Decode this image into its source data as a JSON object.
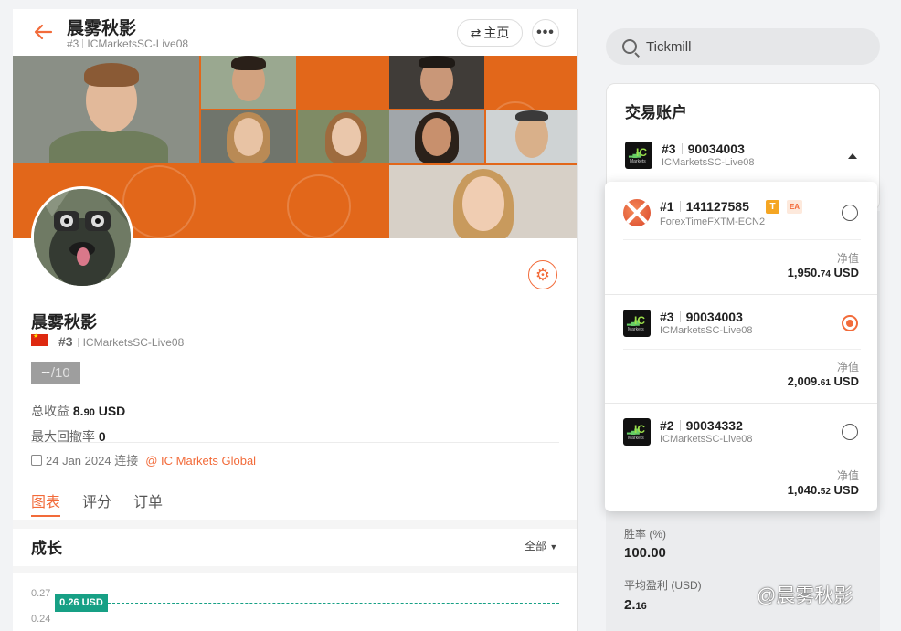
{
  "header": {
    "title": "晨雾秋影",
    "rank": "#3",
    "server": "ICMarketsSC-Live08",
    "home_label": "主页",
    "more_label": "•••"
  },
  "profile": {
    "name": "晨雾秋影",
    "rank": "#3",
    "server": "ICMarketsSC-Live08",
    "score_value": "--",
    "score_max": "/10",
    "total_profit_label": "总收益",
    "total_profit_int": "8.",
    "total_profit_dec": "90",
    "total_profit_unit": "USD",
    "max_drawdown_label": "最大回撤率",
    "max_drawdown_value": "0",
    "joined_date": "24 Jan 2024",
    "joined_suffix": "连接",
    "broker": "@ IC Markets Global"
  },
  "tabs": [
    {
      "label": "图表",
      "active": true
    },
    {
      "label": "评分",
      "active": false
    },
    {
      "label": "订单",
      "active": false
    }
  ],
  "growth": {
    "title": "成长",
    "filter_label": "全部",
    "y_ticks": [
      "0.27",
      "0.24"
    ],
    "current_tag": "0.26 USD"
  },
  "search": {
    "value": "Tickmill"
  },
  "account_card": {
    "title": "交易账户",
    "selected": {
      "rank": "#3",
      "number": "90034003",
      "server": "ICMarketsSC-Live08"
    }
  },
  "dropdown": [
    {
      "rank": "#1",
      "number": "141127585",
      "server": "ForexTimeFXTM-ECN2",
      "badges": [
        "T",
        "EA"
      ],
      "equity_label": "净值",
      "equity_int": "1,950.",
      "equity_dec": "74",
      "equity_unit": "USD",
      "selected": false
    },
    {
      "rank": "#3",
      "number": "90034003",
      "server": "ICMarketsSC-Live08",
      "badges": [],
      "equity_label": "净值",
      "equity_int": "2,009.",
      "equity_dec": "61",
      "equity_unit": "USD",
      "selected": true
    },
    {
      "rank": "#2",
      "number": "90034332",
      "server": "ICMarketsSC-Live08",
      "badges": [],
      "equity_label": "净值",
      "equity_int": "1,040.",
      "equity_dec": "52",
      "equity_unit": "USD",
      "selected": false
    }
  ],
  "right_stats": [
    {
      "label": "胜率 (%)",
      "value_int": "100.00",
      "value_dec": ""
    },
    {
      "label": "平均盈利 (USD)",
      "value_int": "2.",
      "value_dec": "16"
    }
  ],
  "watermark": "@晨雾秋影",
  "colors": {
    "accent": "#f26b3a",
    "banner": "#e2671a",
    "teal": "#17a085"
  }
}
